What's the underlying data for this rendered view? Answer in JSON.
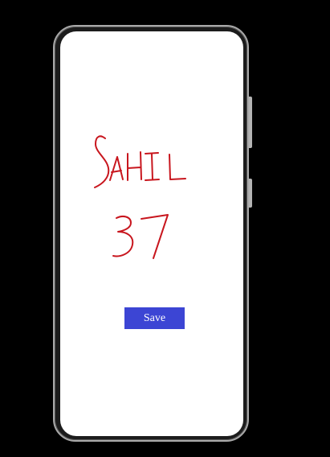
{
  "canvas": {
    "handwriting": [
      "SAHIL",
      "37"
    ],
    "ink_color": "#c8161e",
    "background_color": "#ffffff"
  },
  "save_button": {
    "label": "Save",
    "color": "#3c45d4"
  },
  "device_frame": {
    "color": "#1c1c1c",
    "bezel_color": "#a9a9a9"
  }
}
